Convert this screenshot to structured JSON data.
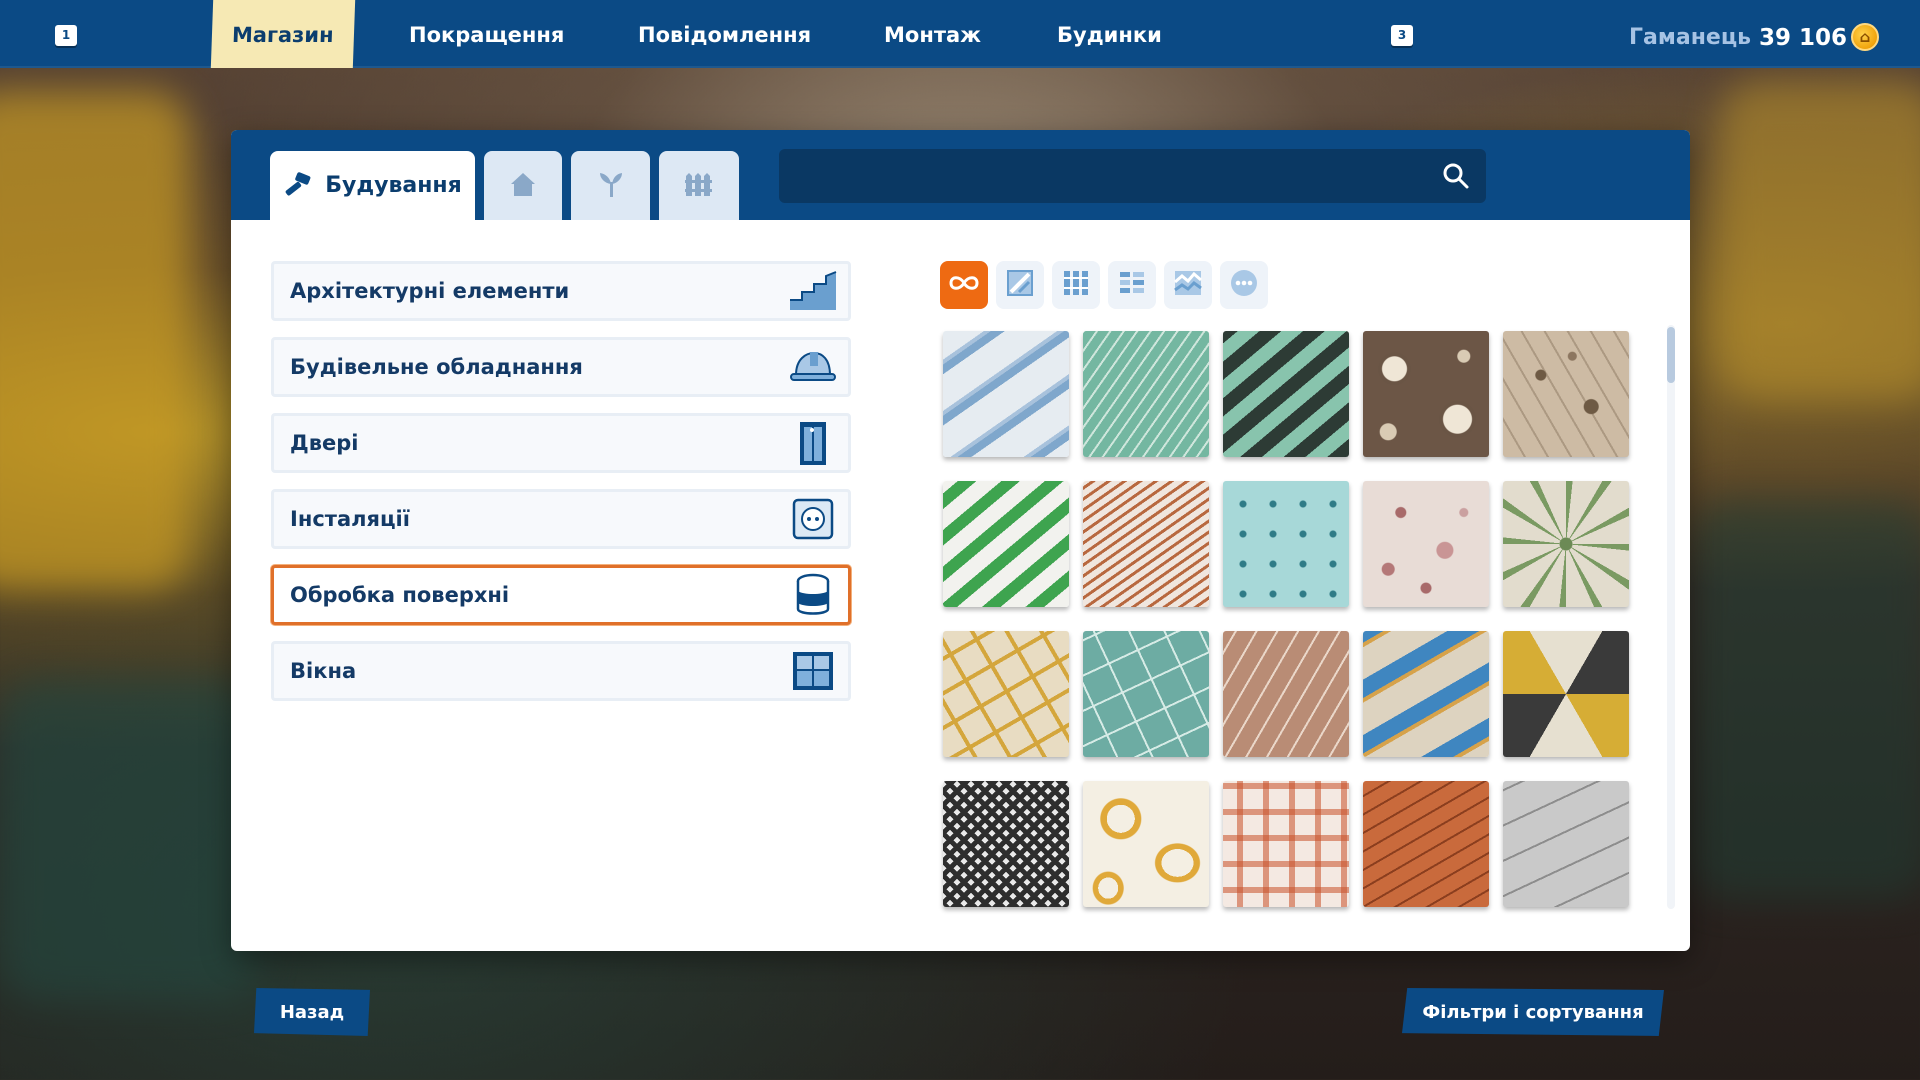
{
  "topbar": {
    "left_key": "1",
    "right_key": "3",
    "nav": [
      "Магазин",
      "Покращення",
      "Повідомлення",
      "Монтаж",
      "Будинки"
    ],
    "active_nav": "Магазин",
    "wallet_label": "Гаманець",
    "wallet_value": "39 106"
  },
  "panel": {
    "tabs": [
      {
        "label": "Будування",
        "icon": "hammer-icon"
      },
      {
        "label": "",
        "icon": "house-icon"
      },
      {
        "label": "",
        "icon": "plant-icon"
      },
      {
        "label": "",
        "icon": "fence-icon"
      }
    ],
    "search": {
      "value": "",
      "placeholder": ""
    },
    "categories": [
      {
        "label": "Архітектурні елементи",
        "icon": "stairs-icon"
      },
      {
        "label": "Будівельне обладнання",
        "icon": "hardhat-icon"
      },
      {
        "label": "Двері",
        "icon": "door-icon"
      },
      {
        "label": "Інсталяції",
        "icon": "socket-icon"
      },
      {
        "label": "Обробка поверхні",
        "icon": "paint-bucket-icon",
        "selected": true
      },
      {
        "label": "Вікна",
        "icon": "window-icon"
      }
    ],
    "filters": [
      "infinity-icon",
      "wall-paint-icon",
      "wallpaper-icon",
      "tiles-icon",
      "floor-icon",
      "more-icon"
    ],
    "active_filter": "infinity-icon",
    "tiles": [
      "blue-white-stripes",
      "teal-herringbone",
      "green-black-diagonal",
      "brown-dahlia-floral",
      "beige-botanical",
      "green-white-stripes",
      "orange-pinstripe",
      "aqua-polka-dot",
      "pink-bubbles",
      "cream-medallion",
      "mustard-grid",
      "teal-grid",
      "terracotta-pinstripe",
      "blue-waves",
      "yellow-black-hexagon",
      "houndstooth",
      "yellow-brush-strokes",
      "red-plaid",
      "brick-red",
      "grey-stone-pavers"
    ]
  },
  "bottom": {
    "back_label": "Назад",
    "filters_label": "Фільтри і сортування"
  },
  "colors": {
    "brand_blue": "#0b4a85",
    "accent_orange": "#ee6a12",
    "active_tab": "#f6e9b4"
  }
}
